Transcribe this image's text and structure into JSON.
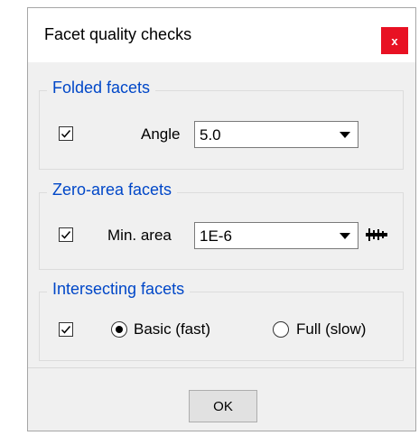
{
  "window": {
    "title": "Facet quality checks",
    "close_label": "x"
  },
  "folded": {
    "legend": "Folded facets",
    "checked": true,
    "angle_label": "Angle",
    "angle_value": "5.0"
  },
  "zero_area": {
    "legend": "Zero-area facets",
    "checked": true,
    "min_area_label": "Min. area",
    "min_area_value": "1E-6",
    "unit_icon": "ruler-icon"
  },
  "intersecting": {
    "legend": "Intersecting facets",
    "checked": true,
    "options": [
      {
        "label": "Basic (fast)",
        "selected": true
      },
      {
        "label": "Full (slow)",
        "selected": false
      }
    ]
  },
  "footer": {
    "ok_label": "OK"
  }
}
